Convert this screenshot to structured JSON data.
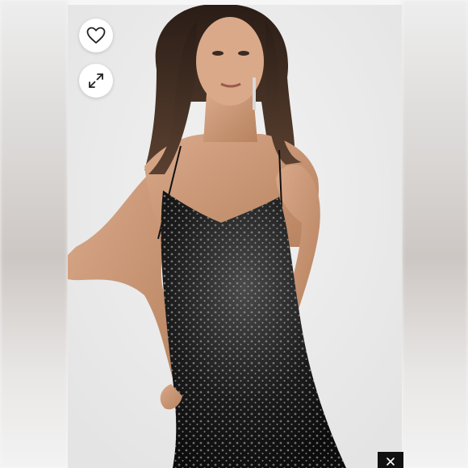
{
  "image": {
    "subject": "model-wearing-black-sequin-slip-dress"
  },
  "actions": [
    {
      "name": "like",
      "icon": "heart-icon"
    },
    {
      "name": "expand",
      "icon": "expand-icon"
    }
  ],
  "overlay": {
    "icon": "close-icon"
  },
  "colors": {
    "background": "#f6f6f6",
    "photo_background": "#ececec",
    "button_background": "#ffffff",
    "icon": "#222222",
    "close_background": "#111111"
  }
}
